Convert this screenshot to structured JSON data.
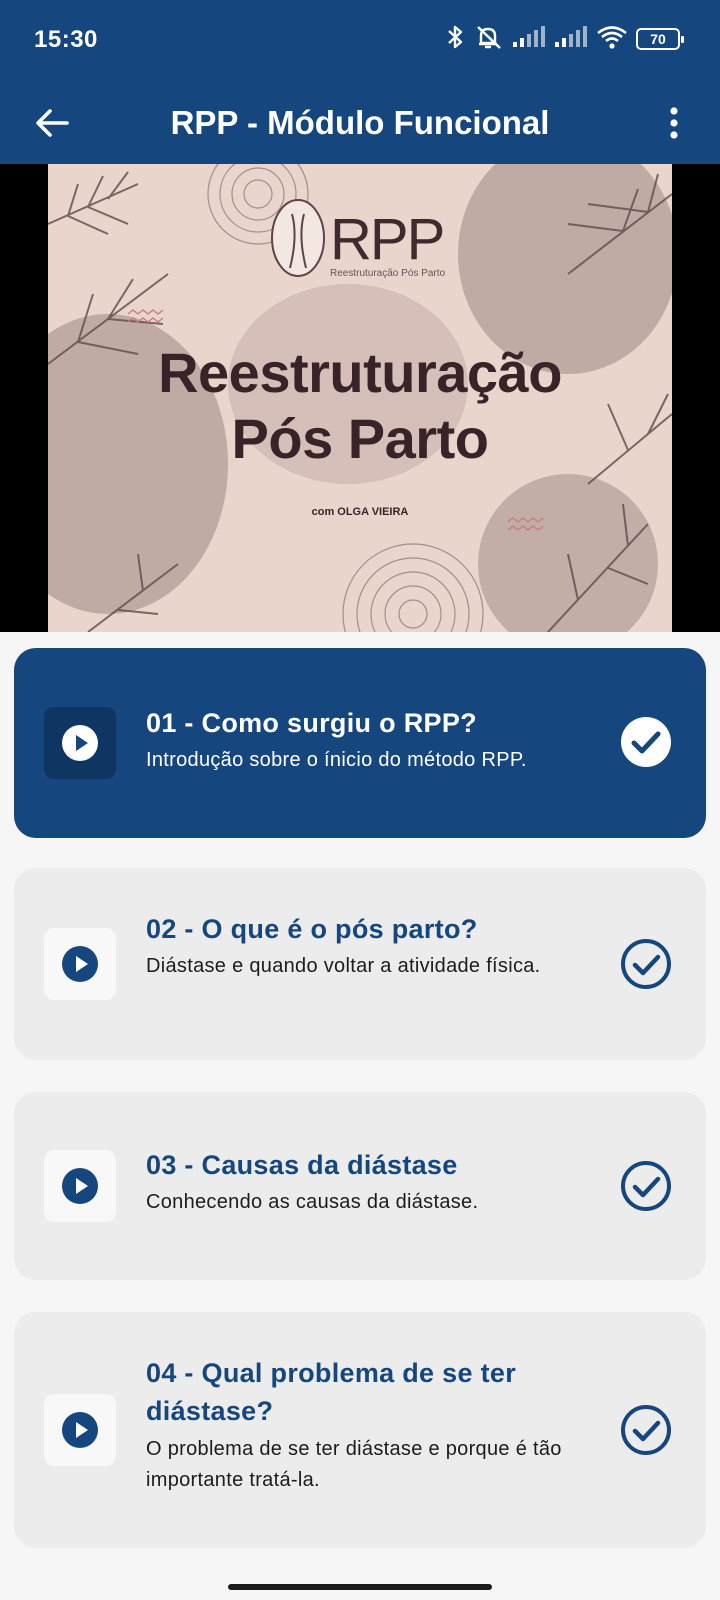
{
  "status_bar": {
    "time": "15:30",
    "battery": "70",
    "icons": [
      "bluetooth-icon",
      "mute-icon",
      "signal-icon",
      "signal-icon",
      "wifi-icon",
      "battery-icon"
    ]
  },
  "app_bar": {
    "title": "RPP - Módulo Funcional",
    "back_icon": "arrow-left-icon",
    "menu_icon": "more-vertical-icon"
  },
  "video": {
    "logo_text": "RPP",
    "logo_subtitle": "Reestruturação Pós Parto",
    "title_line1": "Reestruturação",
    "title_line2": "Pós Parto",
    "author": "com OLGA VIEIRA"
  },
  "lessons": [
    {
      "title": "01 - Como surgiu o RPP?",
      "description": "Introdução sobre o ínicio do método RPP.",
      "active": true,
      "completed": true
    },
    {
      "title": "02 - O que é o pós parto?",
      "description": "Diástase e quando voltar a atividade física.",
      "active": false,
      "completed": true
    },
    {
      "title": "03 - Causas da diástase",
      "description": "Conhecendo as causas da diástase.",
      "active": false,
      "completed": true
    },
    {
      "title": "04 - Qual problema de se ter diástase?",
      "description": "O problema de se ter diástase e porque é tão importante tratá-la.",
      "active": false,
      "completed": true
    }
  ],
  "colors": {
    "primary": "#15467e",
    "card": "#ececed",
    "background": "#f6f6f7"
  }
}
